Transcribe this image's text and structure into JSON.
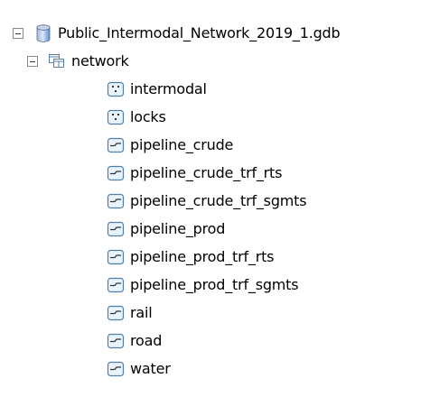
{
  "tree": {
    "root": {
      "label": "Public_Intermodal_Network_2019_1.gdb",
      "icon": "geodatabase-icon",
      "expanded": true
    },
    "dataset": {
      "label": "network",
      "icon": "feature-dataset-icon",
      "expanded": true
    },
    "feature_classes": [
      {
        "label": "intermodal",
        "icon": "point-feature-class-icon"
      },
      {
        "label": "locks",
        "icon": "point-feature-class-icon"
      },
      {
        "label": "pipeline_crude",
        "icon": "line-feature-class-icon"
      },
      {
        "label": "pipeline_crude_trf_rts",
        "icon": "line-feature-class-icon"
      },
      {
        "label": "pipeline_crude_trf_sgmts",
        "icon": "line-feature-class-icon"
      },
      {
        "label": "pipeline_prod",
        "icon": "line-feature-class-icon"
      },
      {
        "label": "pipeline_prod_trf_rts",
        "icon": "line-feature-class-icon"
      },
      {
        "label": "pipeline_prod_trf_sgmts",
        "icon": "line-feature-class-icon"
      },
      {
        "label": "rail",
        "icon": "line-feature-class-icon"
      },
      {
        "label": "road",
        "icon": "line-feature-class-icon"
      },
      {
        "label": "water",
        "icon": "line-feature-class-icon"
      }
    ]
  },
  "colors": {
    "icon_border": "#4f7fa9",
    "icon_fill": "#e9f3fb",
    "database_blue": "#5b8fd6",
    "expander_border": "#8a8a8a"
  }
}
